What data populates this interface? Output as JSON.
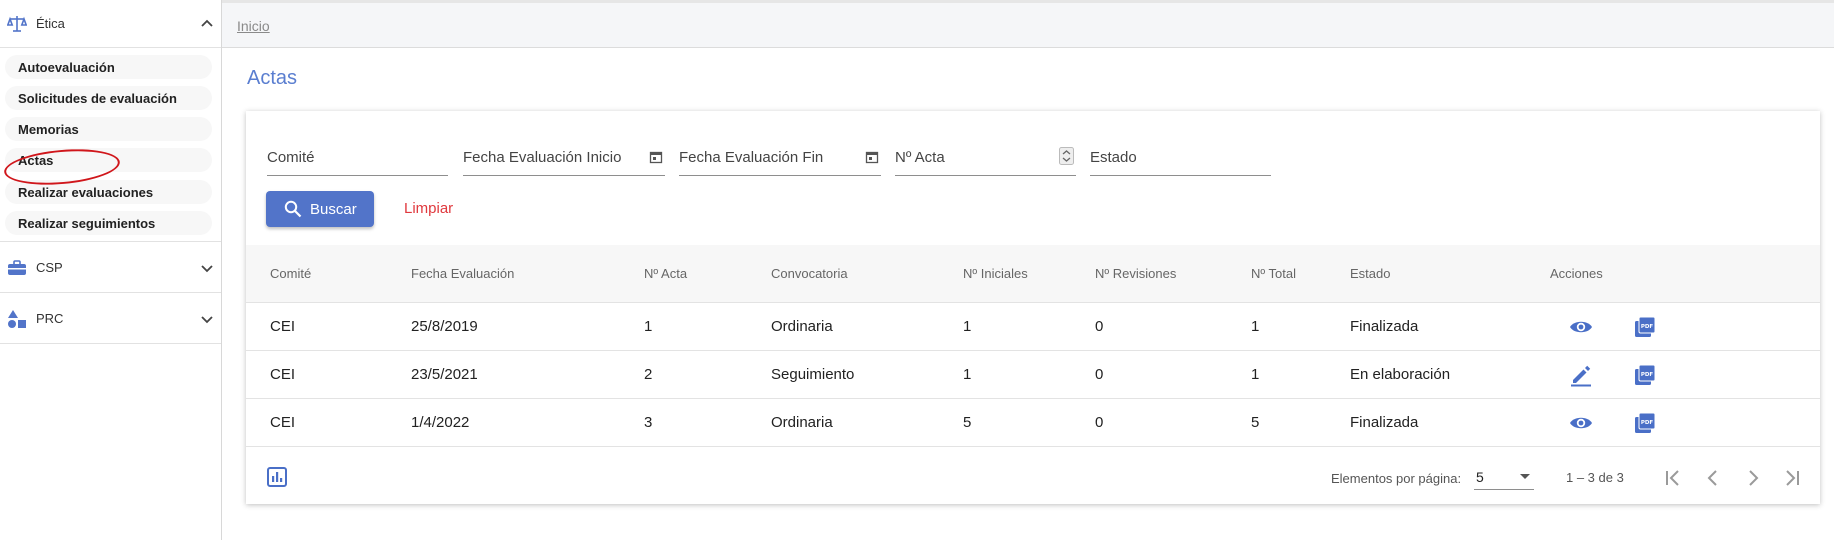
{
  "sidebar": {
    "sections": [
      {
        "label": "Ética",
        "icon": "scales-icon",
        "expanded": true
      },
      {
        "label": "CSP",
        "icon": "briefcase-icon",
        "expanded": false
      },
      {
        "label": "PRC",
        "icon": "shapes-icon",
        "expanded": false
      }
    ],
    "items": [
      {
        "label": "Autoevaluación"
      },
      {
        "label": "Solicitudes de evaluación"
      },
      {
        "label": "Memorias"
      },
      {
        "label": "Actas",
        "active": true
      },
      {
        "label": "Realizar evaluaciones"
      },
      {
        "label": "Realizar seguimientos"
      }
    ]
  },
  "header": {
    "breadcrumb": "Inicio"
  },
  "page": {
    "title": "Actas"
  },
  "filters": {
    "comite": "Comité",
    "fecha_inicio": "Fecha Evaluación Inicio",
    "fecha_fin": "Fecha Evaluación Fin",
    "num_acta": "Nº Acta",
    "estado": "Estado",
    "search_label": "Buscar",
    "clear_label": "Limpiar"
  },
  "table": {
    "columns": [
      "Comité",
      "Fecha Evaluación",
      "Nº Acta",
      "Convocatoria",
      "Nº Iniciales",
      "Nº Revisiones",
      "Nº Total",
      "Estado",
      "Acciones"
    ],
    "rows": [
      {
        "comite": "CEI",
        "fecha": "25/8/2019",
        "acta": "1",
        "convocatoria": "Ordinaria",
        "iniciales": "1",
        "revisiones": "0",
        "total": "1",
        "estado": "Finalizada",
        "action": "view"
      },
      {
        "comite": "CEI",
        "fecha": "23/5/2021",
        "acta": "2",
        "convocatoria": "Seguimiento",
        "iniciales": "1",
        "revisiones": "0",
        "total": "1",
        "estado": "En elaboración",
        "action": "edit"
      },
      {
        "comite": "CEI",
        "fecha": "1/4/2022",
        "acta": "3",
        "convocatoria": "Ordinaria",
        "iniciales": "5",
        "revisiones": "0",
        "total": "5",
        "estado": "Finalizada",
        "action": "view"
      }
    ]
  },
  "paginator": {
    "items_per_page_label": "Elementos por página:",
    "page_size": "5",
    "range": "1 – 3 de 3"
  },
  "colors": {
    "accent": "#5274c9",
    "title": "#5a7ed0",
    "danger": "#e0393e",
    "annotation": "#d0161b"
  }
}
